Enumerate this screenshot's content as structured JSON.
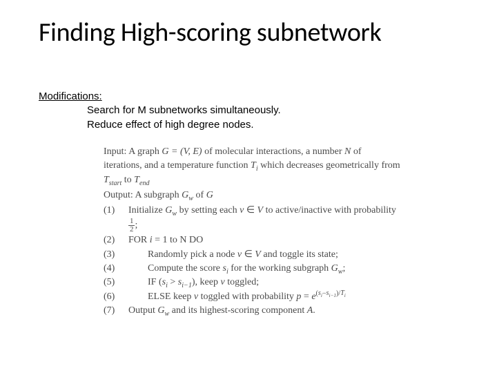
{
  "title": "Finding High-scoring subnetwork",
  "modifications": {
    "heading": "Modifications:",
    "line1": "Search for M subnetworks simultaneously.",
    "line2": "Reduce effect of high degree nodes."
  },
  "algorithm": {
    "input_label": "Input:",
    "input_text_a": "A graph ",
    "input_graph": "G = (V, E)",
    "input_text_b": " of molecular interactions, a number ",
    "input_N": "N",
    "input_text_c": " of iterations, and a temperature function ",
    "input_Ti": "T",
    "input_Ti_sub": "i",
    "input_text_d": " which decreases geometrically from ",
    "input_Tstart": "T",
    "input_Tstart_sub": "start",
    "input_text_e": " to   ",
    "input_Tend": "T",
    "input_Tend_sub": "end",
    "output_label": "Output:",
    "output_text_a": " A subgraph ",
    "output_Gw": "G",
    "output_Gw_sub": "w",
    "output_text_b": " of ",
    "output_G": "G",
    "s1_num": "(1)",
    "s1_a": "Initialize ",
    "s1_Gw": "G",
    "s1_Gw_sub": "w",
    "s1_b": " by setting each ",
    "s1_v": "v",
    "s1_in": " ∈ ",
    "s1_V": "V",
    "s1_c": " to active/inactive with probability ",
    "s1_half_n": "1",
    "s1_half_d": "2",
    "s1_semi": ";",
    "s2_num": "(2)",
    "s2_a": "FOR ",
    "s2_i": "i",
    "s2_b": " = 1 to N DO",
    "s3_num": "(3)",
    "s3_a": "Randomly pick a node ",
    "s3_v": "v",
    "s3_in": " ∈ ",
    "s3_V": "V",
    "s3_b": " and toggle its state;",
    "s4_num": "(4)",
    "s4_a": "Compute the score ",
    "s4_s": "s",
    "s4_s_sub": "i",
    "s4_b": " for the working subgraph ",
    "s4_Gw": "G",
    "s4_Gw_sub": "w",
    "s4_semi": ";",
    "s5_num": "(5)",
    "s5_a": "IF (",
    "s5_si": "s",
    "s5_si_sub": "i",
    "s5_gt": " > ",
    "s5_sim1": "s",
    "s5_sim1_sub": "i−1",
    "s5_b": "), keep ",
    "s5_v": "v",
    "s5_c": " toggled;",
    "s6_num": "(6)",
    "s6_a": "ELSE keep ",
    "s6_v": "v",
    "s6_b": " toggled with probability ",
    "s6_p": "p",
    "s6_eq": " = ",
    "s6_e": "e",
    "s6_exp_a": "(",
    "s6_exp_si": "s",
    "s6_exp_si_sub": "i",
    "s6_exp_minus": "−",
    "s6_exp_sim1": "s",
    "s6_exp_sim1_sub": "i−1",
    "s6_exp_b": ")/",
    "s6_exp_T": "T",
    "s6_exp_T_sub": "i",
    "s7_num": "(7)",
    "s7_a": "Output  ",
    "s7_Gw": "G",
    "s7_Gw_sub": "w",
    "s7_b": " and its highest-scoring component ",
    "s7_A": "A",
    "s7_dot": "."
  }
}
